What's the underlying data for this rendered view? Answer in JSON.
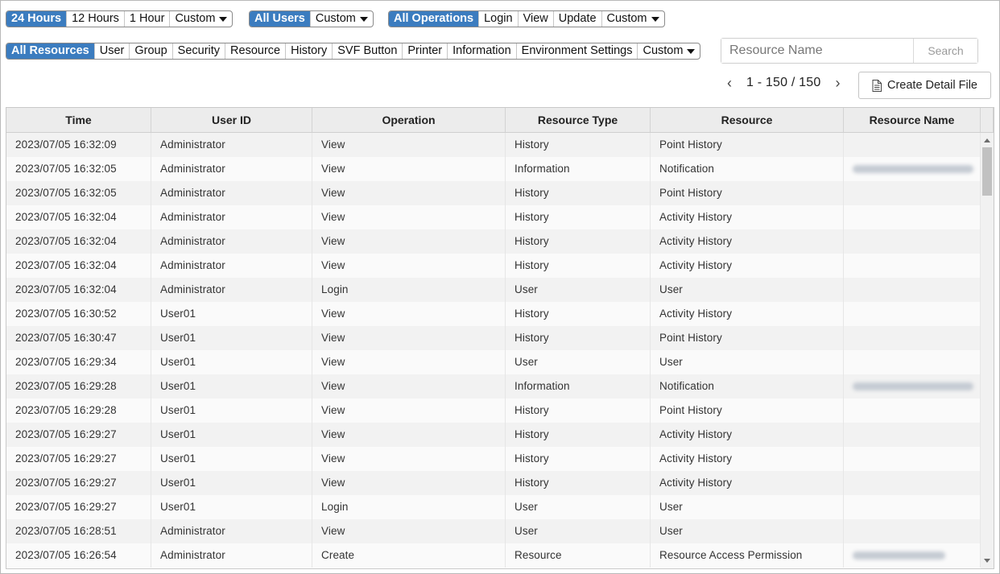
{
  "filters": {
    "time": {
      "options": [
        "24 Hours",
        "12 Hours",
        "1 Hour"
      ],
      "custom_label": "Custom"
    },
    "users": {
      "options": [
        "All Users"
      ],
      "custom_label": "Custom"
    },
    "operations": {
      "options": [
        "All Operations",
        "Login",
        "View",
        "Update"
      ],
      "custom_label": "Custom"
    },
    "resources": {
      "options": [
        "All Resources",
        "User",
        "Group",
        "Security",
        "Resource",
        "History",
        "SVF Button",
        "Printer",
        "Information",
        "Environment Settings"
      ],
      "custom_label": "Custom"
    }
  },
  "search": {
    "placeholder": "Resource Name",
    "button_label": "Search"
  },
  "pager": {
    "range": "1 - 150 / 150",
    "prev_icon": "chevron-left-icon",
    "next_icon": "chevron-right-icon"
  },
  "detail_button": {
    "label": "Create Detail File",
    "icon": "document-icon"
  },
  "table": {
    "columns": [
      "Time",
      "User ID",
      "Operation",
      "Resource Type",
      "Resource",
      "Resource Name"
    ],
    "rows": [
      [
        "2023/07/05 16:32:09",
        "Administrator",
        "View",
        "History",
        "Point History",
        ""
      ],
      [
        "2023/07/05 16:32:05",
        "Administrator",
        "View",
        "Information",
        "Notification",
        ""
      ],
      [
        "2023/07/05 16:32:05",
        "Administrator",
        "View",
        "History",
        "Point History",
        ""
      ],
      [
        "2023/07/05 16:32:04",
        "Administrator",
        "View",
        "History",
        "Activity History",
        ""
      ],
      [
        "2023/07/05 16:32:04",
        "Administrator",
        "View",
        "History",
        "Activity History",
        ""
      ],
      [
        "2023/07/05 16:32:04",
        "Administrator",
        "View",
        "History",
        "Activity History",
        ""
      ],
      [
        "2023/07/05 16:32:04",
        "Administrator",
        "Login",
        "User",
        "User",
        ""
      ],
      [
        "2023/07/05 16:30:52",
        "User01",
        "View",
        "History",
        "Activity History",
        ""
      ],
      [
        "2023/07/05 16:30:47",
        "User01",
        "View",
        "History",
        "Point History",
        ""
      ],
      [
        "2023/07/05 16:29:34",
        "User01",
        "View",
        "User",
        "User",
        ""
      ],
      [
        "2023/07/05 16:29:28",
        "User01",
        "View",
        "Information",
        "Notification",
        ""
      ],
      [
        "2023/07/05 16:29:28",
        "User01",
        "View",
        "History",
        "Point History",
        ""
      ],
      [
        "2023/07/05 16:29:27",
        "User01",
        "View",
        "History",
        "Activity History",
        ""
      ],
      [
        "2023/07/05 16:29:27",
        "User01",
        "View",
        "History",
        "Activity History",
        ""
      ],
      [
        "2023/07/05 16:29:27",
        "User01",
        "View",
        "History",
        "Activity History",
        ""
      ],
      [
        "2023/07/05 16:29:27",
        "User01",
        "Login",
        "User",
        "User",
        ""
      ],
      [
        "2023/07/05 16:28:51",
        "Administrator",
        "View",
        "User",
        "User",
        ""
      ],
      [
        "2023/07/05 16:26:54",
        "Administrator",
        "Create",
        "Resource",
        "Resource Access Permission",
        ""
      ]
    ],
    "redacted_rows": [
      1,
      10,
      17
    ]
  }
}
